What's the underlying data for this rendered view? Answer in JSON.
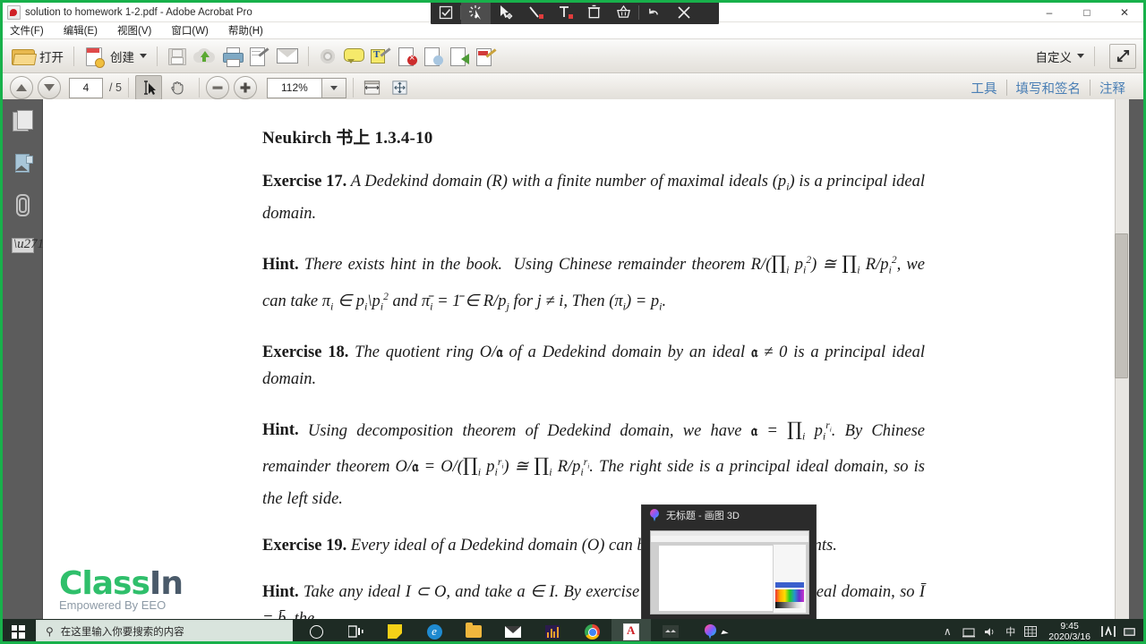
{
  "window": {
    "title": "solution to homework 1-2.pdf - Adobe Acrobat Pro",
    "app_icon": "acrobat-icon",
    "minimize": "–",
    "maximize": "□",
    "close": "✕"
  },
  "menubar": [
    {
      "label": "文件(F)",
      "name": "menu-file"
    },
    {
      "label": "编辑(E)",
      "name": "menu-edit"
    },
    {
      "label": "视图(V)",
      "name": "menu-view"
    },
    {
      "label": "窗口(W)",
      "name": "menu-window"
    },
    {
      "label": "帮助(H)",
      "name": "menu-help"
    }
  ],
  "toolbar_main": {
    "open_label": "打开",
    "create_label": "创建",
    "customize_label": "自定义",
    "icons": [
      "folder-open-icon",
      "create-pdf-icon",
      "save-icon",
      "cloud-upload-icon",
      "print-icon",
      "sign-document-icon",
      "email-icon",
      "gear-icon",
      "comment-bubble-icon",
      "text-edit-icon",
      "delete-pages-icon",
      "refresh-document-icon",
      "export-document-icon",
      "stamp-edit-icon",
      "fullscreen-icon"
    ]
  },
  "toolbar_nav": {
    "prev_page": "previous-page-icon",
    "next_page": "next-page-icon",
    "current_page": "4",
    "page_total": "/ 5",
    "select_tool": "text-select-icon",
    "hand_tool": "hand-tool-icon",
    "zoom_out": "zoom-out-icon",
    "zoom_in": "zoom-in-icon",
    "zoom_value": "112%",
    "zoom_dropdown": "chevron-down-icon",
    "fit_width": "fit-width-icon",
    "fit_page": "fit-page-icon",
    "links": [
      {
        "label": "工具",
        "name": "tools-link"
      },
      {
        "label": "填写和签名",
        "name": "fill-and-sign-link"
      },
      {
        "label": "注释",
        "name": "comment-link"
      }
    ]
  },
  "left_rail": [
    {
      "name": "page-thumbnails-icon"
    },
    {
      "name": "bookmarks-icon"
    },
    {
      "name": "attachments-icon"
    },
    {
      "name": "signatures-icon"
    }
  ],
  "float_toolbar": {
    "items": [
      {
        "name": "checkbox-tool-icon",
        "glyph": "☑"
      },
      {
        "name": "laser-pointer-icon",
        "glyph": "✦"
      },
      {
        "name": "move-cursor-icon",
        "glyph": "➤"
      },
      {
        "name": "pen-tool-icon",
        "glyph": "╱"
      },
      {
        "name": "text-tool-icon",
        "glyph": "T"
      },
      {
        "name": "trash-icon",
        "glyph": "Ὕ1"
      },
      {
        "name": "basket-icon",
        "glyph": "⌂"
      },
      {
        "name": "undo-icon",
        "glyph": "↶"
      },
      {
        "name": "close-toolbar-icon",
        "glyph": "✕"
      }
    ]
  },
  "document": {
    "heading": "Neukirch 书上 1.3.4-10",
    "blocks": [
      {
        "name": "exercise-17",
        "label": "Exercise 17.",
        "text": "A Dedekind domain (R) with a finite number of maximal ideals (pᵢ) is a principal ideal domain."
      },
      {
        "name": "hint-17",
        "label": "Hint.",
        "text": "There exists hint in the book.  Using Chinese remainder theorem R/(∏ᵢ pᵢ²) ≅ ∏ᵢ R/pᵢ², we can take πᵢ ∈ pᵢ\\pᵢ² and π̄ᵢ = 1̄ ∈ R/pⱼ for j ≠ i, Then (πᵢ) = pᵢ."
      },
      {
        "name": "exercise-18",
        "label": "Exercise 18.",
        "text": "The quotient ring O/𝔞 of a Dedekind domain by an ideal 𝔞 ≠ 0 is a principal ideal domain."
      },
      {
        "name": "hint-18",
        "label": "Hint.",
        "text": "Using decomposition theorem of Dedekind domain, we have 𝔞 = ∏ᵢ pᵢ^{rᵢ}. By Chinese remainder theorem O/𝔞 = O/(∏ᵢ pᵢ^{rᵢ}) ≅ ∏ᵢ R/pᵢ^{rᵢ}. The right side is a principal ideal domain, so is the left side."
      },
      {
        "name": "exercise-19",
        "label": "Exercise 19.",
        "text": "Every ideal of a Dedekind domain (O) can be generated by two elements."
      },
      {
        "name": "hint-19",
        "label": "Hint.",
        "text": "Take any ideal I ⊂ O, and take a ∈ I. By exercise above, O/a is principal ideal domain, so Ī = b̄, the"
      }
    ]
  },
  "watermark": {
    "logo_class": "Class",
    "logo_in": "In",
    "tagline": "Empowered By EEO"
  },
  "thumbnail_popup": {
    "title": "无标题 - 画图 3D",
    "icon": "paint3d-icon"
  },
  "taskbar": {
    "start": "windows-start-icon",
    "search_placeholder": "在这里输入你要搜索的内容",
    "search_icon": "search-icon",
    "apps": [
      {
        "name": "cortana-icon"
      },
      {
        "name": "task-view-icon"
      },
      {
        "name": "sticky-notes-icon"
      },
      {
        "name": "edge-browser-icon"
      },
      {
        "name": "file-explorer-icon"
      },
      {
        "name": "mail-icon"
      },
      {
        "name": "analytics-app-icon"
      },
      {
        "name": "chrome-browser-icon"
      },
      {
        "name": "acrobat-reader-icon"
      },
      {
        "name": "classin-app-icon"
      },
      {
        "name": "paint3d-icon"
      }
    ],
    "tray": {
      "chevron": "∧",
      "network_icon": "network-icon",
      "volume_icon": "volume-icon",
      "ime_label": "中",
      "keyboard_icon": "keyboard-icon",
      "time": "9:45",
      "date": "2020/3/16",
      "meter_icon": "monitor-meter-icon",
      "notification_icon": "notification-icon"
    }
  },
  "colors": {
    "share_border": "#18b14b",
    "link_blue": "#4a7fb5",
    "taskbar_bg": "#1e2b24",
    "classin_green": "#2fbf6b",
    "classin_navy": "#4a5a6a"
  }
}
